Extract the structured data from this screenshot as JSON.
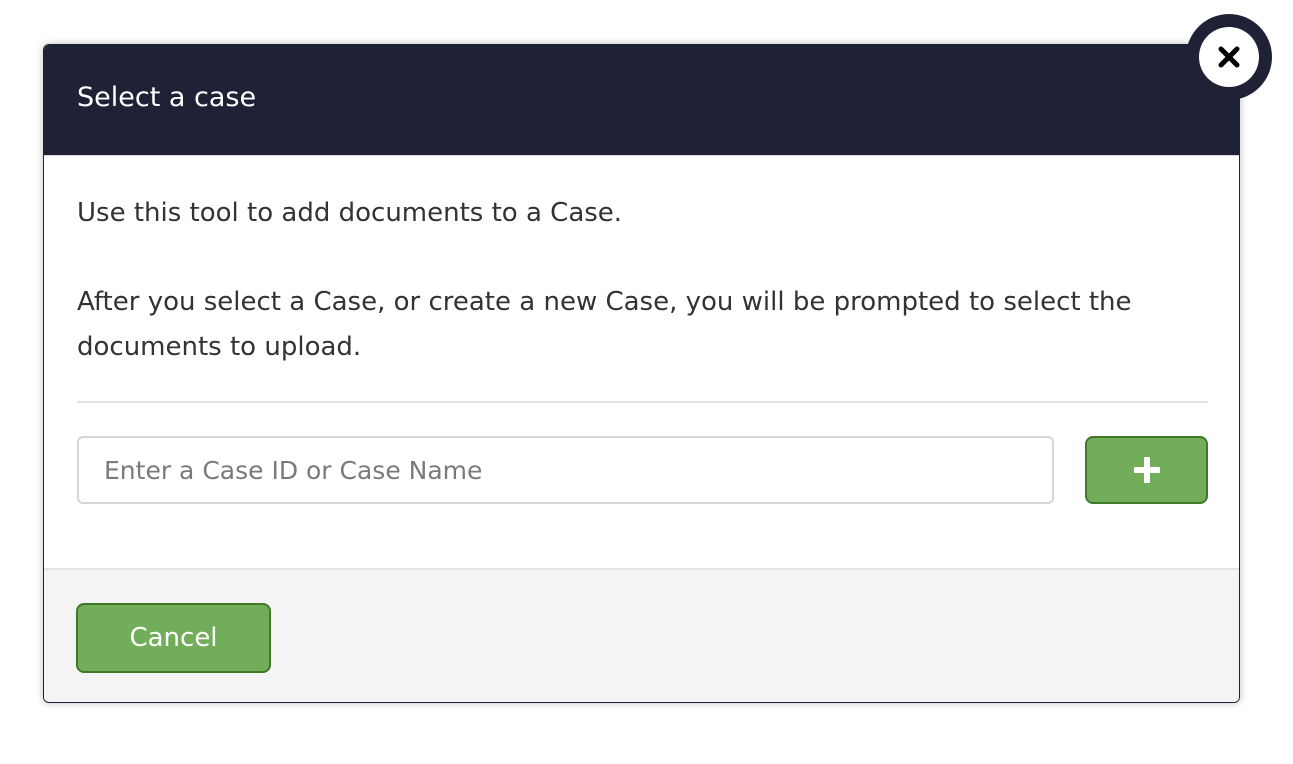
{
  "modal": {
    "title": "Select a case",
    "intro_text": "Use this tool to add documents to a Case.",
    "instruction_text": "After you select a Case, or create a new Case, you will be prompted to select the documents to upload.",
    "case_search": {
      "placeholder": "Enter a Case ID or Case Name",
      "value": ""
    },
    "add_button_icon": "plus-icon",
    "cancel_label": "Cancel",
    "close_icon": "close-icon"
  },
  "colors": {
    "header_bg": "#1f2236",
    "button_green": "#72ad5a",
    "button_border": "#3f7a29",
    "footer_bg": "#f4f4f4"
  }
}
